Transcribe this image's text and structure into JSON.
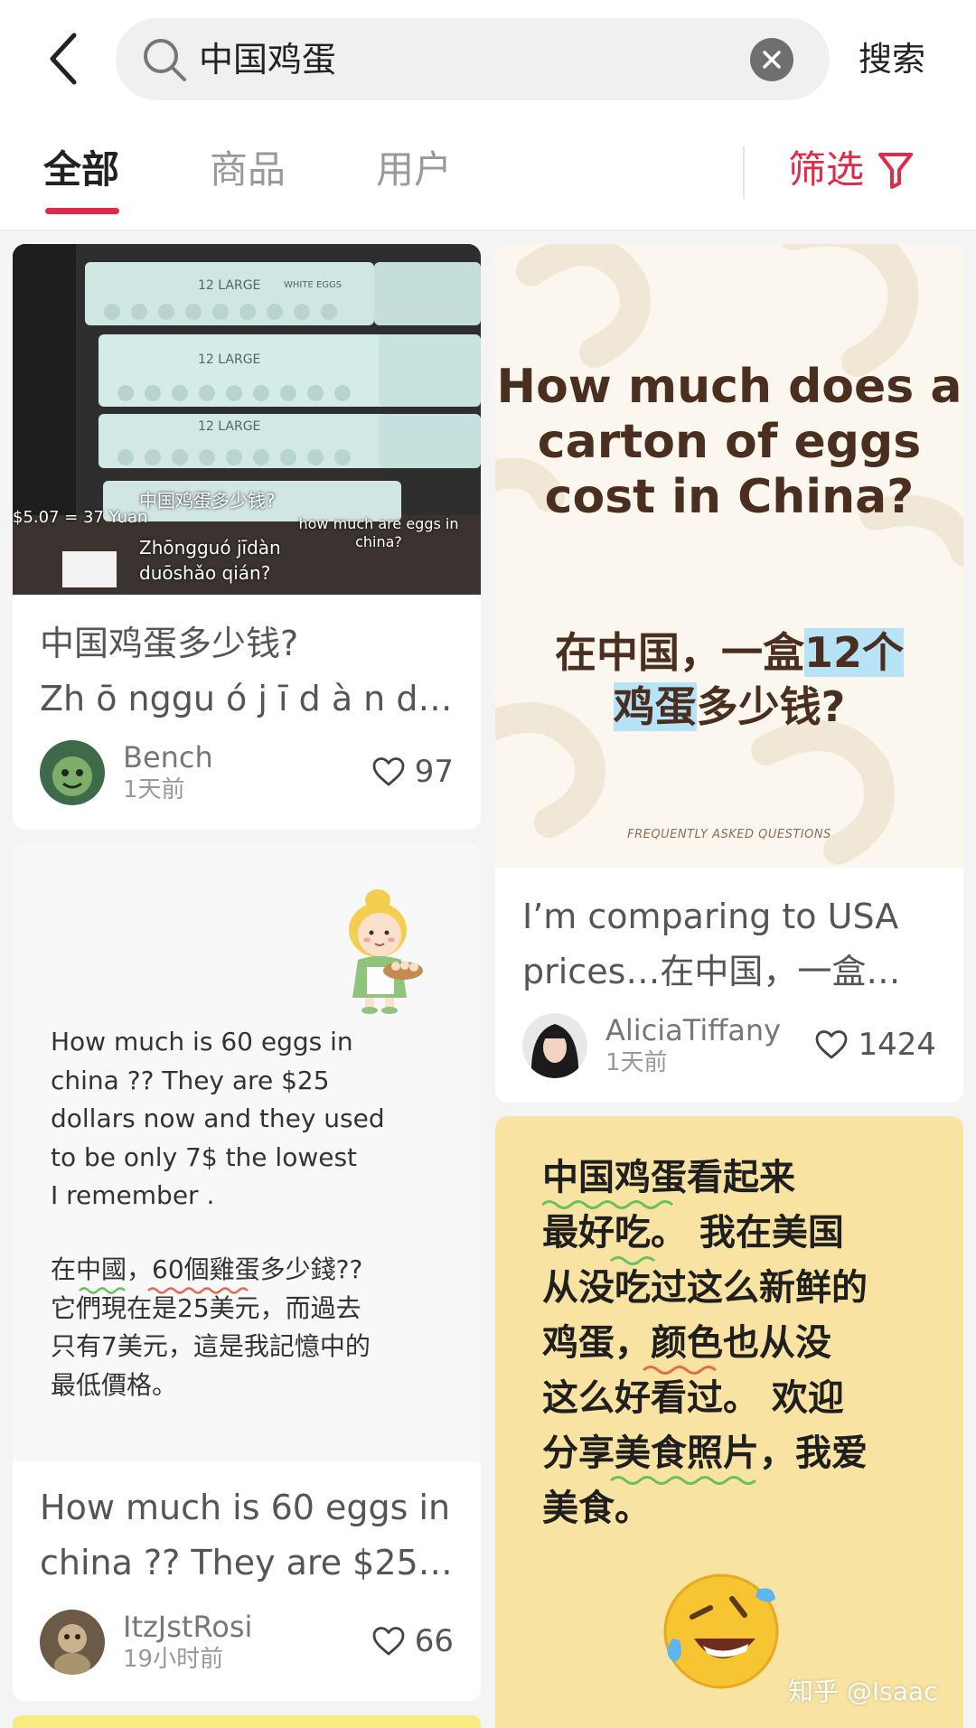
{
  "search": {
    "query": "中国鸡蛋",
    "action_label": "搜索"
  },
  "tabs": [
    {
      "label": "全部",
      "active": true
    },
    {
      "label": "商品",
      "active": false
    },
    {
      "label": "用户",
      "active": false
    }
  ],
  "filter": {
    "label": "筛选"
  },
  "colors": {
    "accent": "#e02a48",
    "card_bg": "#ffffff",
    "page_bg": "#f4f4f4",
    "yellow_card": "#f8e3a2"
  },
  "cards": [
    {
      "image_texts": {
        "carton_label": "12 LARGE",
        "carton_sub": "WHITE EGGS",
        "price": "$5.07 = 37 Yuan",
        "question_cn": "中国鸡蛋多少钱?",
        "pinyin_1": "Zhōngguó jīdàn",
        "pinyin_2": "duōshǎo qián?",
        "question_en": "how much are eggs in china?"
      },
      "title_line1": "中国鸡蛋多少钱?",
      "title_line2": "Zh ō nggu ó j ī d à n d…",
      "author": "Bench",
      "time": "1天前",
      "likes": "97"
    },
    {
      "image_texts": {
        "headline_en": "How much does a carton of eggs cost in China?",
        "headline_cn_1a": "在中国，一盒",
        "headline_cn_1b": "12个",
        "headline_cn_2a": "鸡蛋",
        "headline_cn_2b": "多少钱?",
        "footer": "FREQUENTLY ASKED QUESTIONS"
      },
      "title_line1": "I’m comparing to USA",
      "title_line2": "prices…在中国，一盒…",
      "author": "AliciaTiffany",
      "time": "1天前",
      "likes": "1424"
    },
    {
      "body_en": "How much is 60 eggs in\nchina ?? They are $25\ndollars now and they used\n to be only 7$ the lowest\nI remember .",
      "body_cn": "在中國，60個雞蛋多少錢??\n它們現在是25美元，而過去\n只有7美元，這是我記憶中的\n最低價格。",
      "title_line1": "How much is 60 eggs in",
      "title_line2": "china ?? They are $25 d…",
      "author": "ItzJstRosi",
      "time": "19小时前",
      "likes": "66"
    },
    {
      "body": "中国鸡蛋看起来\n最好吃。 我在美国\n从没吃过这么新鲜的\n鸡蛋，颜色也从没\n这么好看过。 欢迎\n分享美食照片，我爱\n美食。"
    }
  ],
  "watermark": "知乎 @Isaac"
}
